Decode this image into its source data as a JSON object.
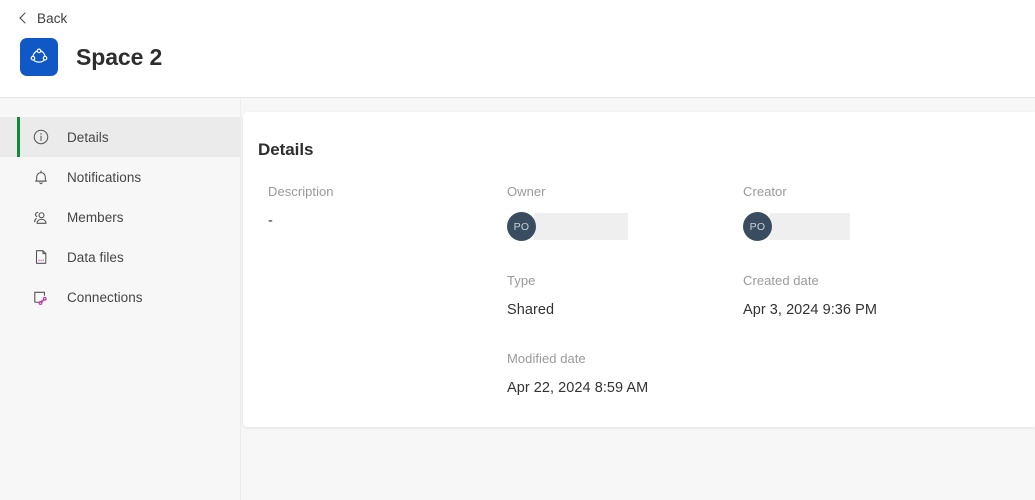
{
  "header": {
    "back_label": "Back",
    "back_icon": "chevron-left-icon",
    "space_icon": "space-node-graph-icon",
    "title": "Space 2",
    "brand_color": "#1158c7"
  },
  "sidebar": {
    "active_indicator_color": "#0e8c3d",
    "items": [
      {
        "label": "Details",
        "icon": "info-circle-icon",
        "active": true
      },
      {
        "label": "Notifications",
        "icon": "bell-icon",
        "active": false
      },
      {
        "label": "Members",
        "icon": "people-icon",
        "active": false
      },
      {
        "label": "Data files",
        "icon": "file-document-icon",
        "active": false
      },
      {
        "label": "Connections",
        "icon": "connections-icon",
        "active": false
      }
    ]
  },
  "main": {
    "title": "Details",
    "fields": {
      "description": {
        "label": "Description",
        "value": "-"
      },
      "owner": {
        "label": "Owner",
        "avatar_initials": "PO",
        "value_redacted": true
      },
      "creator": {
        "label": "Creator",
        "avatar_initials": "PO",
        "value_redacted": true
      },
      "type": {
        "label": "Type",
        "value": "Shared"
      },
      "created_date": {
        "label": "Created date",
        "value": "Apr 3, 2024 9:36 PM"
      },
      "modified_date": {
        "label": "Modified date",
        "value": "Apr 22, 2024 8:59 AM"
      }
    }
  }
}
